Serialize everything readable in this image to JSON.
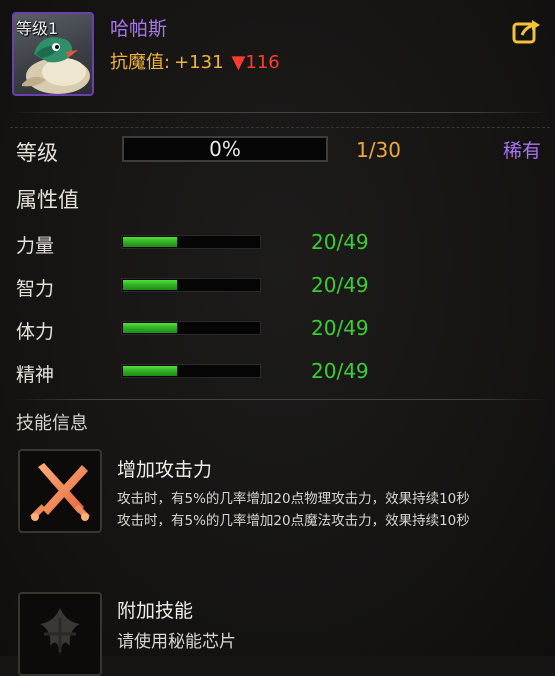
{
  "pet": {
    "level_badge": "等级1",
    "name": "哈帕斯",
    "resist_label": "抗魔值:",
    "resist_value": "+131",
    "resist_down_arrow": "▼",
    "resist_down_value": "116"
  },
  "level_row": {
    "label": "等级",
    "exp_percent_text": "0%",
    "exp_fraction": 0.0,
    "count": "1/30",
    "rarity": "稀有"
  },
  "attributes": {
    "title": "属性值",
    "items": [
      {
        "label": "力量",
        "value": "20/49",
        "fraction": 0.408
      },
      {
        "label": "智力",
        "value": "20/49",
        "fraction": 0.408
      },
      {
        "label": "体力",
        "value": "20/49",
        "fraction": 0.408
      },
      {
        "label": "精神",
        "value": "20/49",
        "fraction": 0.408
      }
    ]
  },
  "skills": {
    "title": "技能信息",
    "items": [
      {
        "icon": "crossed-swords-icon",
        "name": "增加攻击力",
        "desc_lines": [
          "攻击时，有5%的几率增加20点物理攻击力，效果持续10秒",
          "攻击时，有5%的几率增加20点魔法攻击力，效果持续10秒"
        ]
      },
      {
        "icon": "locked-skill-icon",
        "name": "附加技能",
        "desc_lines": [
          "请使用秘能芯片"
        ]
      }
    ]
  },
  "colors": {
    "purple_name": "#a775f0",
    "gold": "#f0b43a",
    "red_down": "#ff3b30",
    "green_value": "#3ccd34"
  }
}
